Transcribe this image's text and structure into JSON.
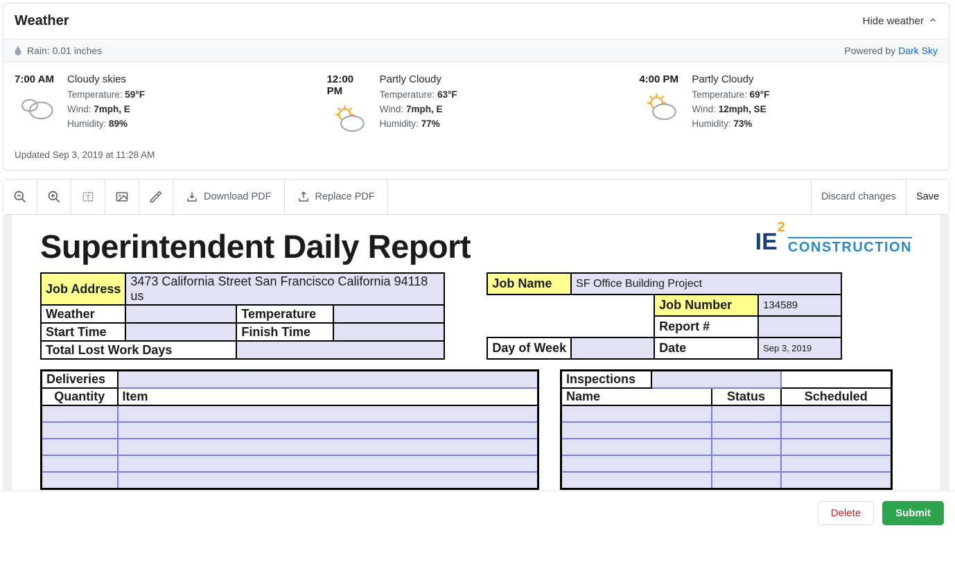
{
  "weather_card": {
    "title": "Weather",
    "hide_label": "Hide weather",
    "rain_label": "Rain: 0.01 inches",
    "powered_prefix": "Powered by ",
    "powered_link": "Dark Sky",
    "updated": "Updated Sep 3, 2019 at 11:28 AM",
    "periods": [
      {
        "time": "7:00 AM",
        "condition": "Cloudy skies",
        "temp_label": "Temperature:",
        "temp": "59°F",
        "wind_label": "Wind:",
        "wind": "7mph, E",
        "hum_label": "Humidity:",
        "hum": "89%",
        "icon": "cloud"
      },
      {
        "time": "12:00 PM",
        "condition": "Partly Cloudy",
        "temp_label": "Temperature:",
        "temp": "63°F",
        "wind_label": "Wind:",
        "wind": "7mph, E",
        "hum_label": "Humidity:",
        "hum": "77%",
        "icon": "partly"
      },
      {
        "time": "4:00 PM",
        "condition": "Partly Cloudy",
        "temp_label": "Temperature:",
        "temp": "69°F",
        "wind_label": "Wind:",
        "wind": "12mph, SE",
        "hum_label": "Humidity:",
        "hum": "73%",
        "icon": "partly"
      }
    ]
  },
  "toolbar": {
    "download_pdf": "Download PDF",
    "replace_pdf": "Replace PDF",
    "discard": "Discard changes",
    "save": "Save"
  },
  "doc": {
    "title": "Superintendent Daily Report",
    "logo_ie2": "IE",
    "logo_sup": "2",
    "logo_constr": "CONSTRUCTION",
    "labels": {
      "job_address": "Job Address",
      "weather": "Weather",
      "temperature": "Temperature",
      "start_time": "Start Time",
      "finish_time": "Finish Time",
      "total_lost": "Total Lost Work Days",
      "job_name": "Job Name",
      "job_number": "Job Number",
      "report_num": "Report #",
      "day_of_week": "Day of Week",
      "date": "Date",
      "deliveries": "Deliveries",
      "quantity": "Quantity",
      "item": "Item",
      "inspections": "Inspections",
      "name": "Name",
      "status": "Status",
      "scheduled": "Scheduled"
    },
    "values": {
      "job_address": "3473 California Street San Francisco California 94118 us",
      "job_name": "SF Office Building Project",
      "job_number": "134589",
      "date": "Sep 3, 2019"
    }
  },
  "footer": {
    "delete": "Delete",
    "submit": "Submit"
  }
}
